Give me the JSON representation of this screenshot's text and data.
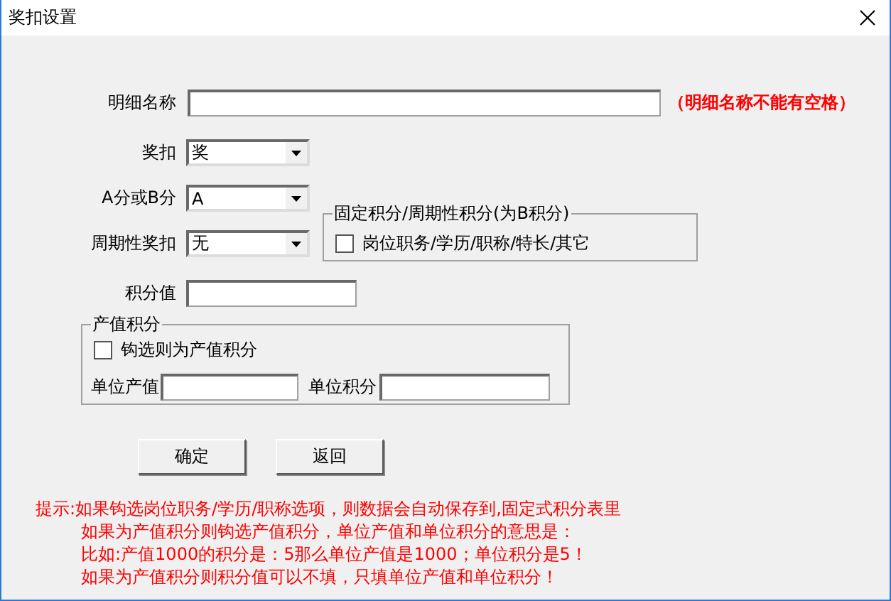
{
  "window": {
    "title": "奖扣设置"
  },
  "name_field": {
    "label": "明细名称"
  },
  "name_note": "（明细名称不能有空格）",
  "dropdowns": [
    {
      "label": "奖扣",
      "value": "奖"
    },
    {
      "label": "A分或B分",
      "value": "A"
    },
    {
      "label": "周期性奖扣",
      "value": "无"
    }
  ],
  "fixed_group": {
    "title": "固定积分/周期性积分(为B积分)",
    "checkbox": {
      "label": "岗位职务/学历/职称/特长/其它",
      "checked": false
    }
  },
  "points_field": {
    "label": "积分值"
  },
  "output_group": {
    "title": "产值积分",
    "checkbox": {
      "label": "钩选则为产值积分",
      "checked": false
    },
    "fields": [
      {
        "label": "单位产值"
      },
      {
        "label": "单位积分"
      }
    ]
  },
  "buttons": [
    "确定",
    "返回"
  ],
  "tips": [
    "提示:如果钩选岗位职务/学历/职称选项，则数据会自动保存到,固定式积分表里",
    "如果为产值积分则钩选产值积分，单位产值和单位积分的意思是：",
    "比如:产值1000的积分是：5那么单位产值是1000；单位积分是5！",
    "如果为产值积分则积分值可以不填，只填单位产值和单位积分！"
  ]
}
